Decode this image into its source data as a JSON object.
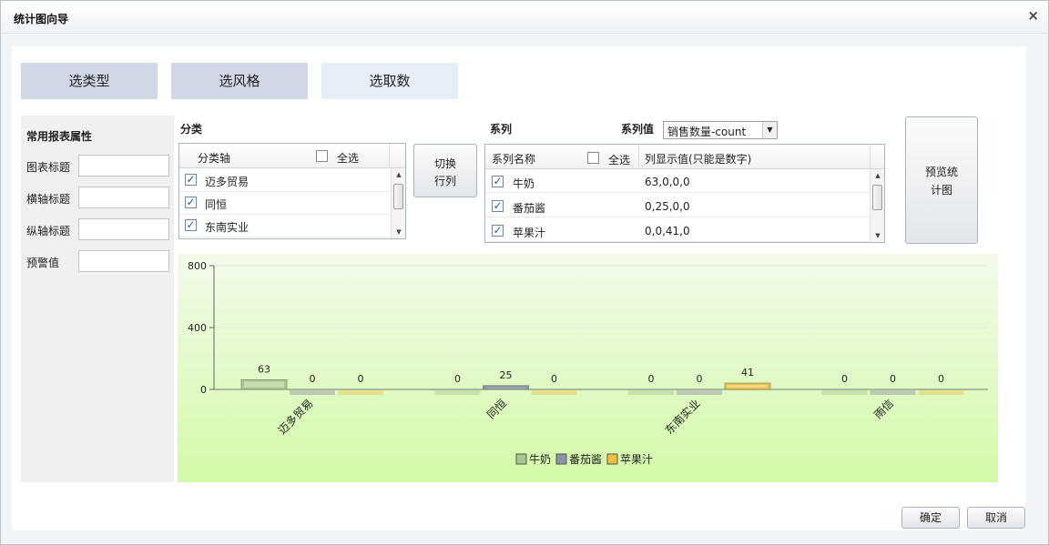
{
  "dialog": {
    "title": "统计图向导",
    "close_icon": "×"
  },
  "steps": [
    "选类型",
    "选风格",
    "选取数"
  ],
  "props": {
    "title": "常用报表属性",
    "fields": [
      {
        "label": "图表标题",
        "value": ""
      },
      {
        "label": "横轴标题",
        "value": ""
      },
      {
        "label": "纵轴标题",
        "value": ""
      },
      {
        "label": "预警值",
        "value": ""
      }
    ]
  },
  "category": {
    "label": "分类",
    "header": "分类轴",
    "select_all": "全选",
    "items": [
      "迈多贸易",
      "同恒",
      "东南实业"
    ]
  },
  "swap_button": "切换行列",
  "series": {
    "label": "系列",
    "value_label": "系列值",
    "value_select": "销售数量-count",
    "header_name": "系列名称",
    "select_all": "全选",
    "header_values": "列显示值(只能是数字)",
    "rows": [
      {
        "name": "牛奶",
        "values": "63,0,0,0"
      },
      {
        "name": "番茄酱",
        "values": "0,25,0,0"
      },
      {
        "name": "苹果汁",
        "values": "0,0,41,0"
      }
    ]
  },
  "preview_button": "预览统计图",
  "footer": {
    "ok": "确定",
    "cancel": "取消"
  },
  "colors": {
    "chart_bg_top": "#f2fbea",
    "chart_bg_bottom": "#d3f9a8",
    "milk": "#a9c98a",
    "ketchup": "#8b93a8",
    "juice": "#f0c040"
  },
  "chart_data": {
    "type": "bar",
    "categories": [
      "迈多贸易",
      "同恒",
      "东南实业",
      "雨信"
    ],
    "series": [
      {
        "name": "牛奶",
        "values": [
          63,
          0,
          0,
          0
        ]
      },
      {
        "name": "番茄酱",
        "values": [
          0,
          25,
          0,
          0
        ]
      },
      {
        "name": "苹果汁",
        "values": [
          0,
          0,
          41,
          0
        ]
      }
    ],
    "yticks": [
      0,
      400,
      800
    ],
    "ylim": [
      0,
      800
    ],
    "legend": "bottom-center",
    "grid": true
  }
}
